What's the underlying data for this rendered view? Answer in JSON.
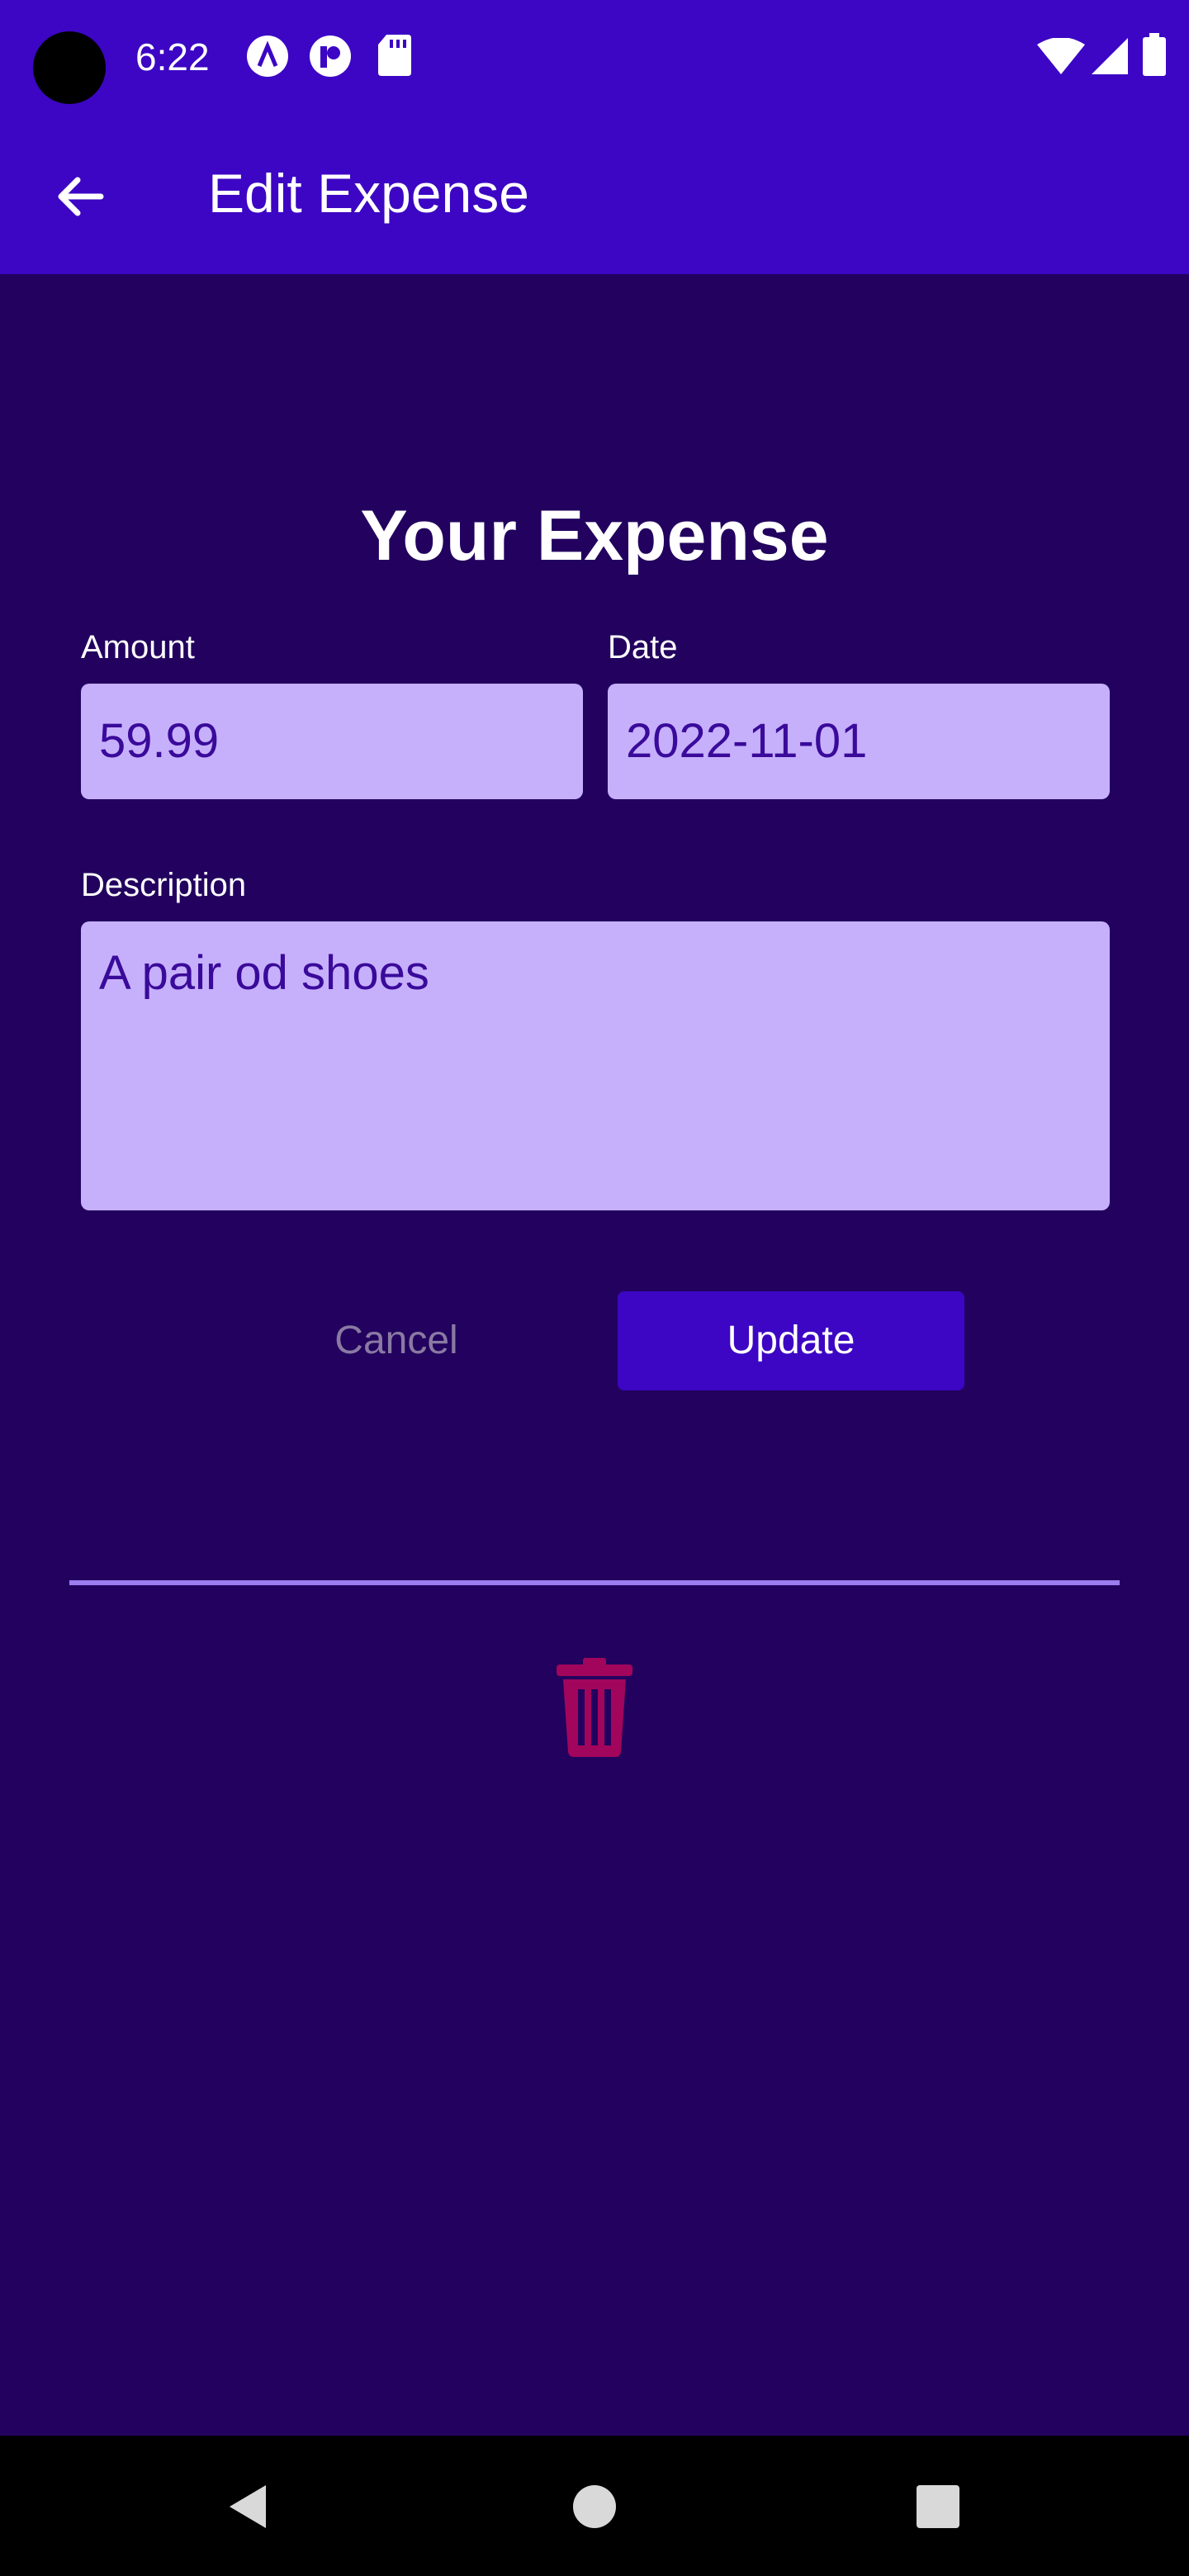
{
  "status_bar": {
    "time": "6:22",
    "icons": [
      "circle-a-icon",
      "circle-p-icon",
      "sd-card-icon",
      "wifi-icon",
      "signal-icon",
      "battery-icon"
    ]
  },
  "app_bar": {
    "back_icon": "arrow-back-icon",
    "title": "Edit Expense",
    "background": "#3c06c4"
  },
  "form": {
    "title": "Your Expense",
    "amount": {
      "label": "Amount",
      "value": "59.99"
    },
    "date": {
      "label": "Date",
      "value": "2022-11-01"
    },
    "description": {
      "label": "Description",
      "value": "A pair od shoes"
    },
    "input_bg": "#c6b0fc",
    "input_text_color": "#3a0a9a"
  },
  "actions": {
    "cancel_label": "Cancel",
    "update_label": "Update",
    "delete_icon": "trash-icon"
  },
  "nav": {
    "icons": [
      "nav-back-icon",
      "nav-home-icon",
      "nav-recents-icon"
    ]
  },
  "colors": {
    "page_bg": "#22025e",
    "accent": "#3c06c4",
    "danger": "#a2055c",
    "divider": "#9b7df0"
  }
}
